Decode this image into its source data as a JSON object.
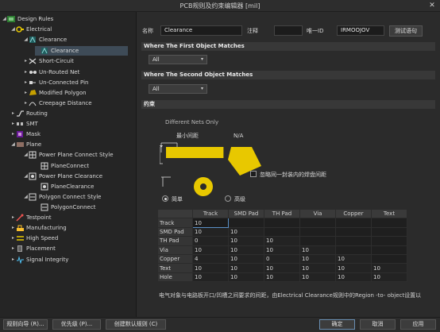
{
  "window": {
    "title": "PCB规则及约束编辑器 [mil]",
    "close_glyph": "✕"
  },
  "tree": {
    "design_rules": "Design Rules",
    "electrical": "Electrical",
    "clearance_group": "Clearance",
    "clearance_rule": "Clearance",
    "short_circuit": "Short-Circuit",
    "un_routed_net": "Un-Routed Net",
    "un_connected_pin": "Un-Connected Pin",
    "modified_polygon": "Modified Polygon",
    "creepage_distance": "Creepage Distance",
    "routing": "Routing",
    "smt": "SMT",
    "mask": "Mask",
    "plane": "Plane",
    "power_plane_connect_style": "Power Plane Connect Style",
    "plane_connect": "PlaneConnect",
    "power_plane_clearance": "Power Plane Clearance",
    "plane_clearance": "PlaneClearance",
    "polygon_connect_style": "Polygon Connect Style",
    "polygon_connect": "PolygonConnect",
    "testpoint": "Testpoint",
    "manufacturing": "Manufacturing",
    "high_speed": "High Speed",
    "placement": "Placement",
    "signal_integrity": "Signal Integrity"
  },
  "rule": {
    "name_label": "名称",
    "name_value": "Clearance",
    "comment_label": "注释",
    "comment_value": "",
    "uid_label": "唯一ID",
    "uid_value": "IRMOOJOV",
    "test_button": "测试语句"
  },
  "first_match": {
    "header": "Where The First Object Matches",
    "value": "All"
  },
  "second_match": {
    "header": "Where The Second Object Matches",
    "value": "All"
  },
  "constraints": {
    "header": "约束",
    "net_scope": "Different Nets Only",
    "min_clearance_label": "最小间距",
    "min_clearance_value": "N/A",
    "ignore_same_net_pads": "忽略同一封装内的焊盘间距",
    "mode_simple": "简单",
    "mode_advanced": "高级",
    "columns": [
      "Track",
      "SMD Pad",
      "TH Pad",
      "Via",
      "Copper",
      "Text"
    ],
    "rows": [
      {
        "name": "Track",
        "values": [
          "10",
          "",
          "",
          "",
          "",
          ""
        ]
      },
      {
        "name": "SMD Pad",
        "values": [
          "10",
          "10",
          "",
          "",
          "",
          ""
        ]
      },
      {
        "name": "TH Pad",
        "values": [
          "0",
          "10",
          "10",
          "",
          "",
          ""
        ]
      },
      {
        "name": "Via",
        "values": [
          "10",
          "10",
          "10",
          "10",
          "",
          ""
        ]
      },
      {
        "name": "Copper",
        "values": [
          "4",
          "10",
          "0",
          "10",
          "10",
          ""
        ]
      },
      {
        "name": "Text",
        "values": [
          "10",
          "10",
          "10",
          "10",
          "10",
          "10"
        ]
      },
      {
        "name": "Hole",
        "values": [
          "10",
          "10",
          "10",
          "10",
          "10",
          "10"
        ]
      }
    ],
    "note": "电气对象与电路板开口/凹槽之间要求的间距，由Electrical Clearance规则中的Region -to- object设置以"
  },
  "footer": {
    "rule_wizard": "规则向导 (R)...",
    "priorities": "优先级 (P)...",
    "create_defaults": "创建默认规则 (C)",
    "ok": "确定",
    "cancel": "取消",
    "apply": "应用"
  },
  "colors": {
    "accent": "#e8c800",
    "selection": "#3e4b57",
    "background": "#2b2b2b"
  }
}
